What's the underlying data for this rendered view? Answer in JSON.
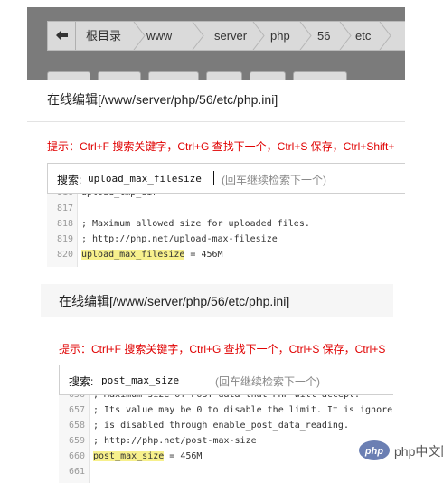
{
  "breadcrumb": {
    "back_icon": "arrow-left-icon",
    "items": [
      "根目录",
      "www",
      "server",
      "php",
      "56",
      "etc"
    ]
  },
  "editor1": {
    "title": "在线编辑[/www/server/php/56/etc/php.ini]",
    "tip": "提示：Ctrl+F 搜索关键字，Ctrl+G 查找下一个，Ctrl+S 保存，Ctrl+Shift+",
    "search_label": "搜索:",
    "search_value": "upload_max_filesize",
    "search_hint": "(回车继续检索下一个)",
    "lines": [
      {
        "num": "816",
        "text": "upload_tmp_dir"
      },
      {
        "num": "817",
        "text": ""
      },
      {
        "num": "818",
        "text": "; Maximum allowed size for uploaded files."
      },
      {
        "num": "819",
        "text": "; http://php.net/upload-max-filesize"
      },
      {
        "num": "820",
        "key": "upload_max_filesize",
        "rest": " = 456M"
      }
    ]
  },
  "editor2": {
    "title": "在线编辑[/www/server/php/56/etc/php.ini]",
    "tip": "提示：Ctrl+F 搜索关键字，Ctrl+G 查找下一个，Ctrl+S 保存，Ctrl+S",
    "search_label": "搜索:",
    "search_value": "post_max_size",
    "search_hint": "(回车继续检索下一个)",
    "lines": [
      {
        "num": "656",
        "text": "; Maximum size of POST data that PHP will accept."
      },
      {
        "num": "657",
        "text": "; Its value may be 0 to disable the limit. It is ignore"
      },
      {
        "num": "658",
        "text": "; is disabled through enable_post_data_reading."
      },
      {
        "num": "659",
        "text": "; http://php.net/post-max-size"
      },
      {
        "num": "660",
        "key": "post_max_size",
        "rest": " = 456M"
      },
      {
        "num": "661",
        "text": ""
      }
    ]
  },
  "watermark": {
    "text": "php中文网",
    "logo_text": "php"
  },
  "colors": {
    "tip": "#e00000",
    "highlight": "#f7f08c",
    "overlay": "#7b7b7b"
  }
}
